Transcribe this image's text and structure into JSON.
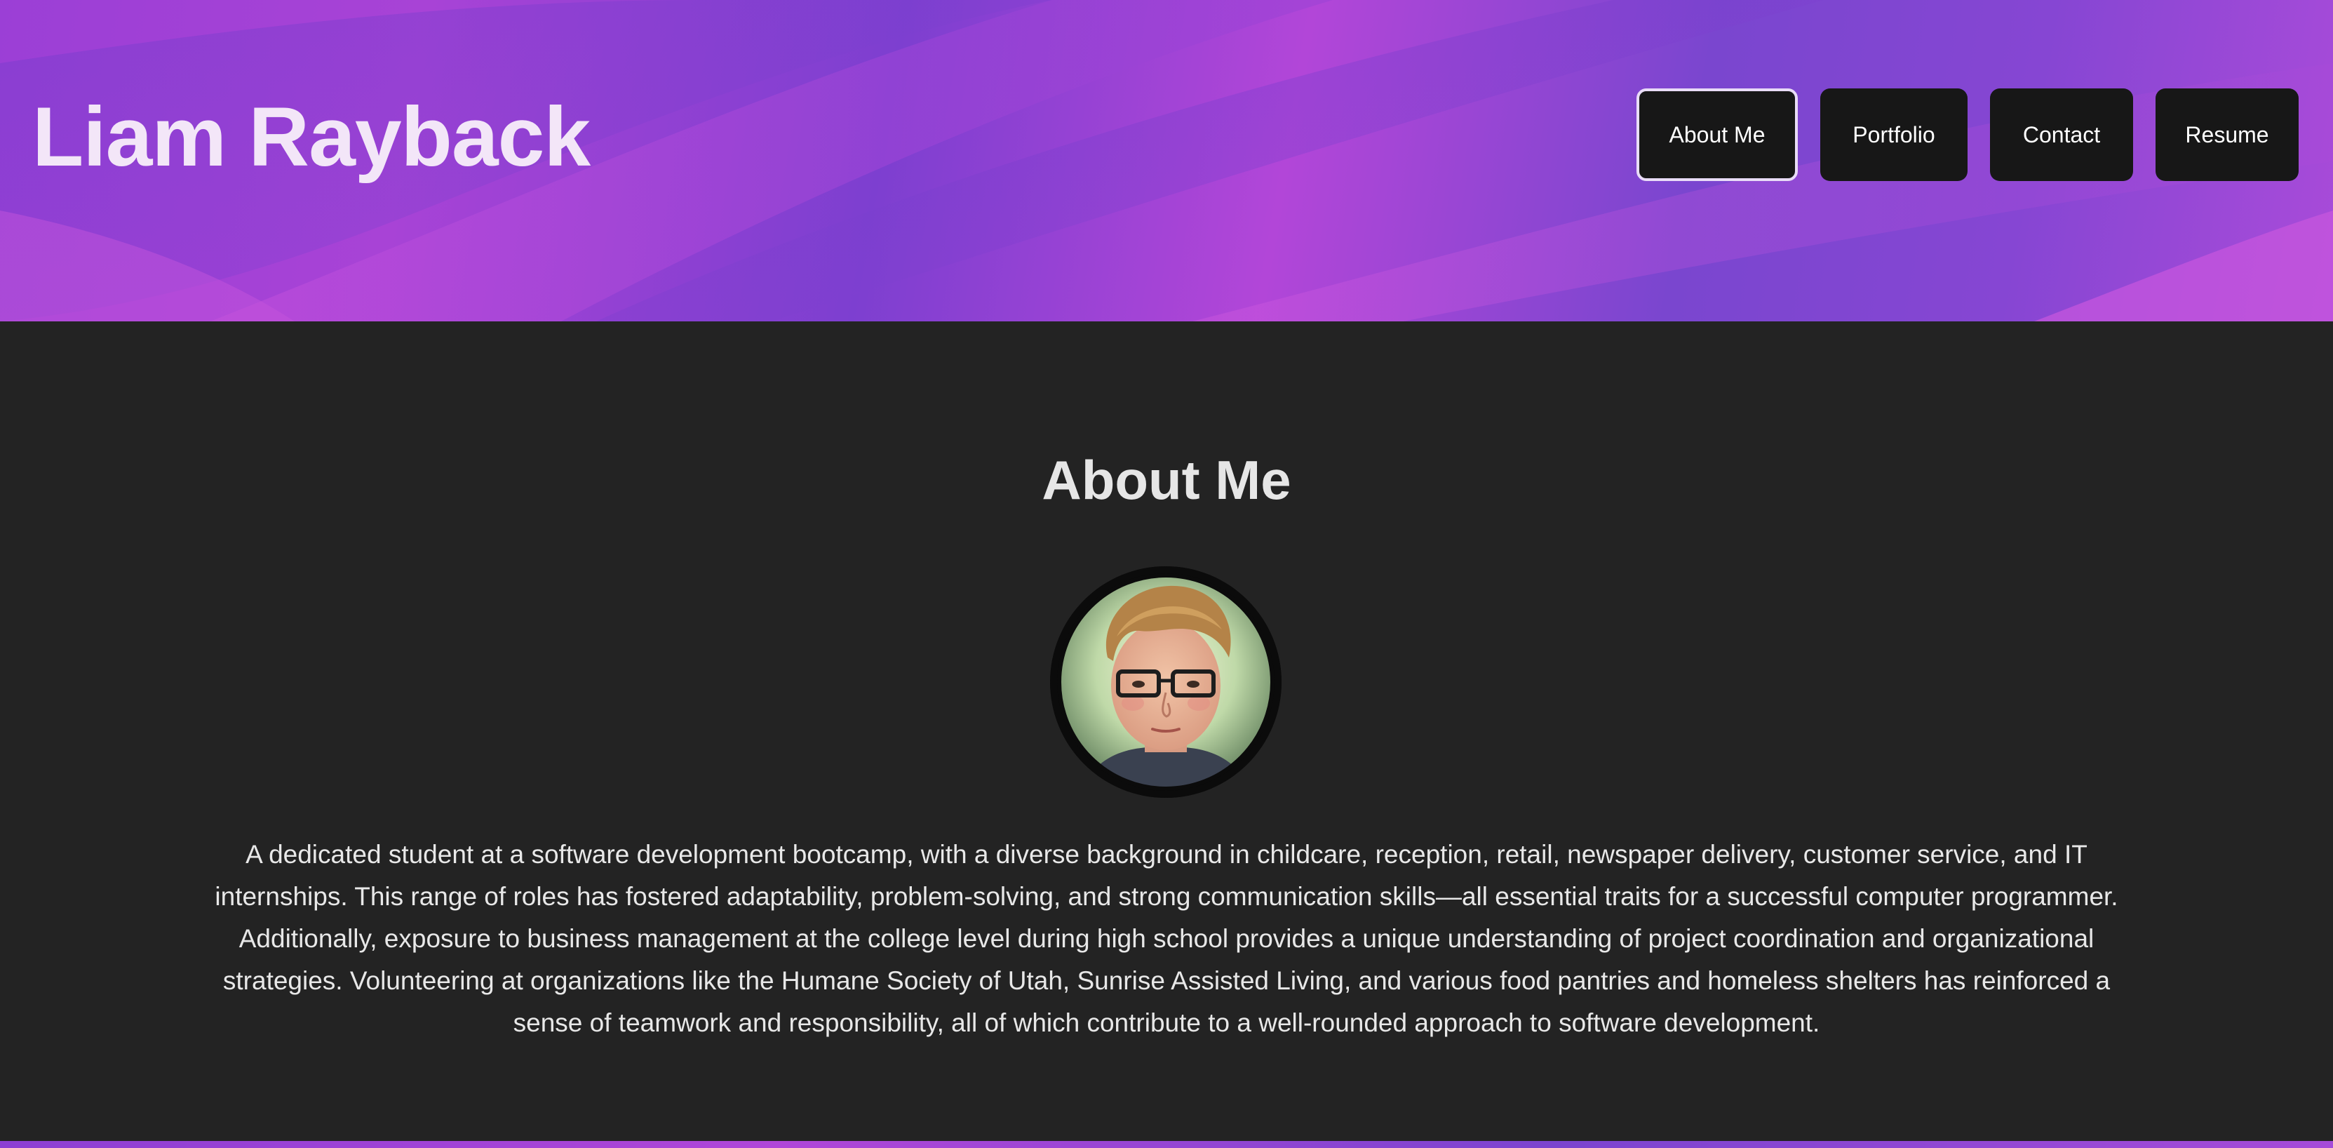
{
  "header": {
    "title": "Liam Rayback",
    "nav": [
      {
        "label": "About Me",
        "active": true
      },
      {
        "label": "Portfolio",
        "active": false
      },
      {
        "label": "Contact",
        "active": false
      },
      {
        "label": "Resume",
        "active": false
      }
    ]
  },
  "about": {
    "heading": "About Me",
    "avatar_icon": "profile-photo",
    "bio": "A dedicated student at a software development bootcamp, with a diverse background in childcare, reception, retail, newspaper delivery, customer service, and IT internships. This range of roles has fostered adaptability, problem-solving, and strong communication skills—all essential traits for a successful computer programmer. Additionally, exposure to business management at the college level during high school provides a unique understanding of project coordination and organizational strategies. Volunteering at organizations like the Humane Society of Utah, Sunrise Assisted Living, and various food pantries and homeless shelters has reinforced a sense of teamwork and responsibility, all of which contribute to a well-rounded approach to software development."
  },
  "colors": {
    "header_accent": "#a843d6",
    "background": "#232323",
    "button_bg": "#171717",
    "title_text": "#f3e6f8"
  }
}
